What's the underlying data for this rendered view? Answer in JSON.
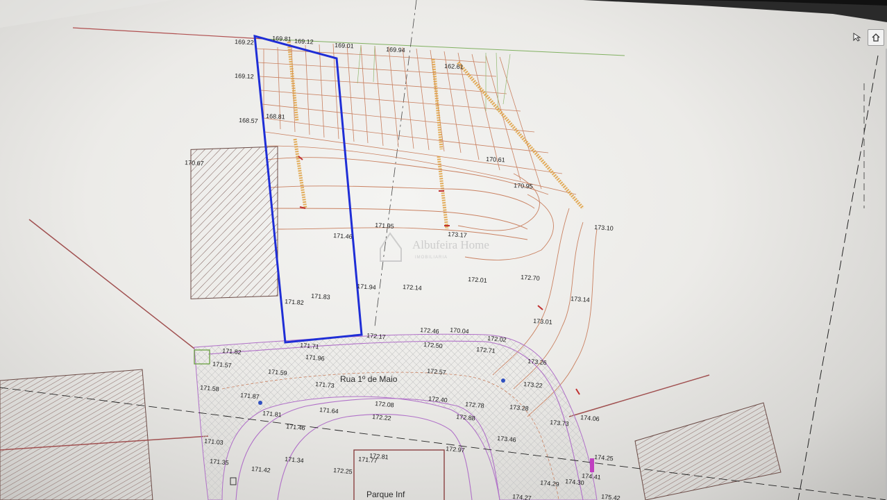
{
  "app": {
    "toolbar": {
      "cursor_icon": "pointer-arrow-icon",
      "home_icon": "home-icon"
    }
  },
  "drawing": {
    "street_label": "Rua 1º de Maio",
    "parking_label": "Parque Inf",
    "watermark": {
      "brand": "Albufeira Home",
      "subtitle": "IMOBILIARIA"
    },
    "colors": {
      "plot_outline": "#1f2ed6",
      "contour": "#c98060",
      "slope_hatch": "#e0a040",
      "road": "#b070c8",
      "parcel_lines": "#8a4040"
    },
    "elevations_top": [
      "169.22",
      "169.81",
      "169.12",
      "168.57",
      "168.81",
      "169.12",
      "169.01",
      "169.94",
      "162.61",
      "170.61",
      "170.95",
      "170.67"
    ],
    "elevations_mid": [
      "171.46",
      "171.95",
      "173.17",
      "173.10",
      "171.82",
      "171.83",
      "171.94",
      "172.14",
      "172.01",
      "172.70",
      "173.14",
      "173.01"
    ],
    "elevations_road": [
      "172.17",
      "172.46",
      "170.04",
      "172.02",
      "171.71",
      "171.82",
      "171.57",
      "171.96",
      "172.50",
      "172.71",
      "173.26",
      "171.59",
      "171.73",
      "172.57",
      "171.58",
      "173.22",
      "171.87",
      "172.08",
      "172.40",
      "172.78",
      "171.81",
      "171.64",
      "172.22",
      "172.88",
      "173.28",
      "171.46",
      "174.06",
      "173.73",
      "171.03",
      "173.46",
      "171.35",
      "171.34",
      "171.42",
      "171.77",
      "172.81",
      "172.97",
      "174.25",
      "172.25",
      "174.41",
      "174.29",
      "174.30",
      "174.27",
      "175.42"
    ]
  }
}
